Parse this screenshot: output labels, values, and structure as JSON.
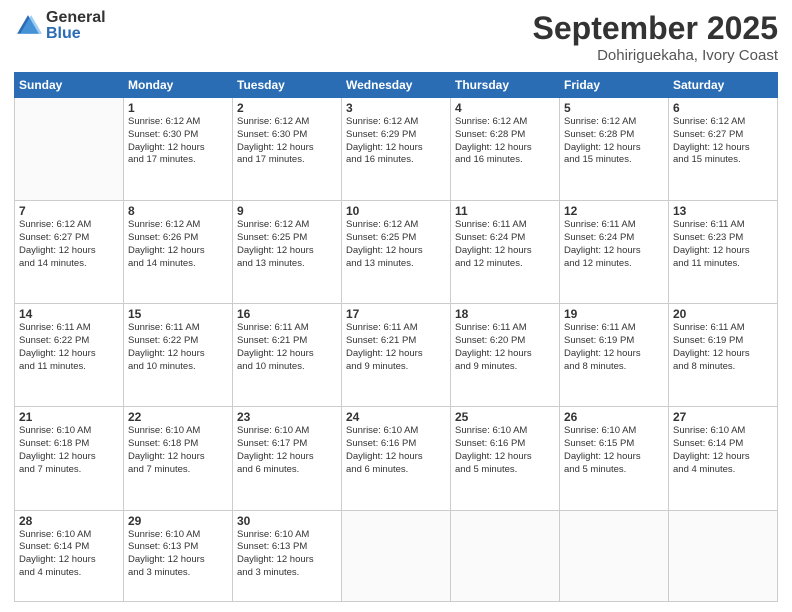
{
  "logo": {
    "general": "General",
    "blue": "Blue"
  },
  "title": {
    "month": "September 2025",
    "location": "Dohiriguekaha, Ivory Coast"
  },
  "days_header": [
    "Sunday",
    "Monday",
    "Tuesday",
    "Wednesday",
    "Thursday",
    "Friday",
    "Saturday"
  ],
  "weeks": [
    [
      {
        "day": "",
        "info": ""
      },
      {
        "day": "1",
        "info": "Sunrise: 6:12 AM\nSunset: 6:30 PM\nDaylight: 12 hours\nand 17 minutes."
      },
      {
        "day": "2",
        "info": "Sunrise: 6:12 AM\nSunset: 6:30 PM\nDaylight: 12 hours\nand 17 minutes."
      },
      {
        "day": "3",
        "info": "Sunrise: 6:12 AM\nSunset: 6:29 PM\nDaylight: 12 hours\nand 16 minutes."
      },
      {
        "day": "4",
        "info": "Sunrise: 6:12 AM\nSunset: 6:28 PM\nDaylight: 12 hours\nand 16 minutes."
      },
      {
        "day": "5",
        "info": "Sunrise: 6:12 AM\nSunset: 6:28 PM\nDaylight: 12 hours\nand 15 minutes."
      },
      {
        "day": "6",
        "info": "Sunrise: 6:12 AM\nSunset: 6:27 PM\nDaylight: 12 hours\nand 15 minutes."
      }
    ],
    [
      {
        "day": "7",
        "info": "Sunrise: 6:12 AM\nSunset: 6:27 PM\nDaylight: 12 hours\nand 14 minutes."
      },
      {
        "day": "8",
        "info": "Sunrise: 6:12 AM\nSunset: 6:26 PM\nDaylight: 12 hours\nand 14 minutes."
      },
      {
        "day": "9",
        "info": "Sunrise: 6:12 AM\nSunset: 6:25 PM\nDaylight: 12 hours\nand 13 minutes."
      },
      {
        "day": "10",
        "info": "Sunrise: 6:12 AM\nSunset: 6:25 PM\nDaylight: 12 hours\nand 13 minutes."
      },
      {
        "day": "11",
        "info": "Sunrise: 6:11 AM\nSunset: 6:24 PM\nDaylight: 12 hours\nand 12 minutes."
      },
      {
        "day": "12",
        "info": "Sunrise: 6:11 AM\nSunset: 6:24 PM\nDaylight: 12 hours\nand 12 minutes."
      },
      {
        "day": "13",
        "info": "Sunrise: 6:11 AM\nSunset: 6:23 PM\nDaylight: 12 hours\nand 11 minutes."
      }
    ],
    [
      {
        "day": "14",
        "info": "Sunrise: 6:11 AM\nSunset: 6:22 PM\nDaylight: 12 hours\nand 11 minutes."
      },
      {
        "day": "15",
        "info": "Sunrise: 6:11 AM\nSunset: 6:22 PM\nDaylight: 12 hours\nand 10 minutes."
      },
      {
        "day": "16",
        "info": "Sunrise: 6:11 AM\nSunset: 6:21 PM\nDaylight: 12 hours\nand 10 minutes."
      },
      {
        "day": "17",
        "info": "Sunrise: 6:11 AM\nSunset: 6:21 PM\nDaylight: 12 hours\nand 9 minutes."
      },
      {
        "day": "18",
        "info": "Sunrise: 6:11 AM\nSunset: 6:20 PM\nDaylight: 12 hours\nand 9 minutes."
      },
      {
        "day": "19",
        "info": "Sunrise: 6:11 AM\nSunset: 6:19 PM\nDaylight: 12 hours\nand 8 minutes."
      },
      {
        "day": "20",
        "info": "Sunrise: 6:11 AM\nSunset: 6:19 PM\nDaylight: 12 hours\nand 8 minutes."
      }
    ],
    [
      {
        "day": "21",
        "info": "Sunrise: 6:10 AM\nSunset: 6:18 PM\nDaylight: 12 hours\nand 7 minutes."
      },
      {
        "day": "22",
        "info": "Sunrise: 6:10 AM\nSunset: 6:18 PM\nDaylight: 12 hours\nand 7 minutes."
      },
      {
        "day": "23",
        "info": "Sunrise: 6:10 AM\nSunset: 6:17 PM\nDaylight: 12 hours\nand 6 minutes."
      },
      {
        "day": "24",
        "info": "Sunrise: 6:10 AM\nSunset: 6:16 PM\nDaylight: 12 hours\nand 6 minutes."
      },
      {
        "day": "25",
        "info": "Sunrise: 6:10 AM\nSunset: 6:16 PM\nDaylight: 12 hours\nand 5 minutes."
      },
      {
        "day": "26",
        "info": "Sunrise: 6:10 AM\nSunset: 6:15 PM\nDaylight: 12 hours\nand 5 minutes."
      },
      {
        "day": "27",
        "info": "Sunrise: 6:10 AM\nSunset: 6:14 PM\nDaylight: 12 hours\nand 4 minutes."
      }
    ],
    [
      {
        "day": "28",
        "info": "Sunrise: 6:10 AM\nSunset: 6:14 PM\nDaylight: 12 hours\nand 4 minutes."
      },
      {
        "day": "29",
        "info": "Sunrise: 6:10 AM\nSunset: 6:13 PM\nDaylight: 12 hours\nand 3 minutes."
      },
      {
        "day": "30",
        "info": "Sunrise: 6:10 AM\nSunset: 6:13 PM\nDaylight: 12 hours\nand 3 minutes."
      },
      {
        "day": "",
        "info": ""
      },
      {
        "day": "",
        "info": ""
      },
      {
        "day": "",
        "info": ""
      },
      {
        "day": "",
        "info": ""
      }
    ]
  ]
}
